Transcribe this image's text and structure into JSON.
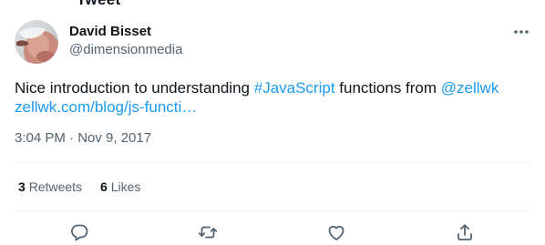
{
  "header": {
    "cut_title": "Tweet"
  },
  "author": {
    "display_name": "David Bisset",
    "handle": "@dimensionmedia",
    "avatar": "profile-photo"
  },
  "tweet": {
    "text_before": "Nice introduction to understanding ",
    "hashtag": "#JavaScript",
    "text_middle": " functions from ",
    "mention": "@zellwk",
    "url": "zellwk.com/blog/js-functi…"
  },
  "meta": {
    "timestamp": "3:04 PM · Nov 9, 2017"
  },
  "stats": {
    "retweets_count": "3",
    "retweets_label": "Retweets",
    "likes_count": "6",
    "likes_label": "Likes"
  },
  "actions": {
    "reply": "reply-icon",
    "retweet": "retweet-icon",
    "like": "heart-icon",
    "share": "share-icon"
  },
  "colors": {
    "link": "#1d9bf0",
    "muted": "#536471",
    "text": "#0f1419",
    "divider": "#eff3f4"
  }
}
